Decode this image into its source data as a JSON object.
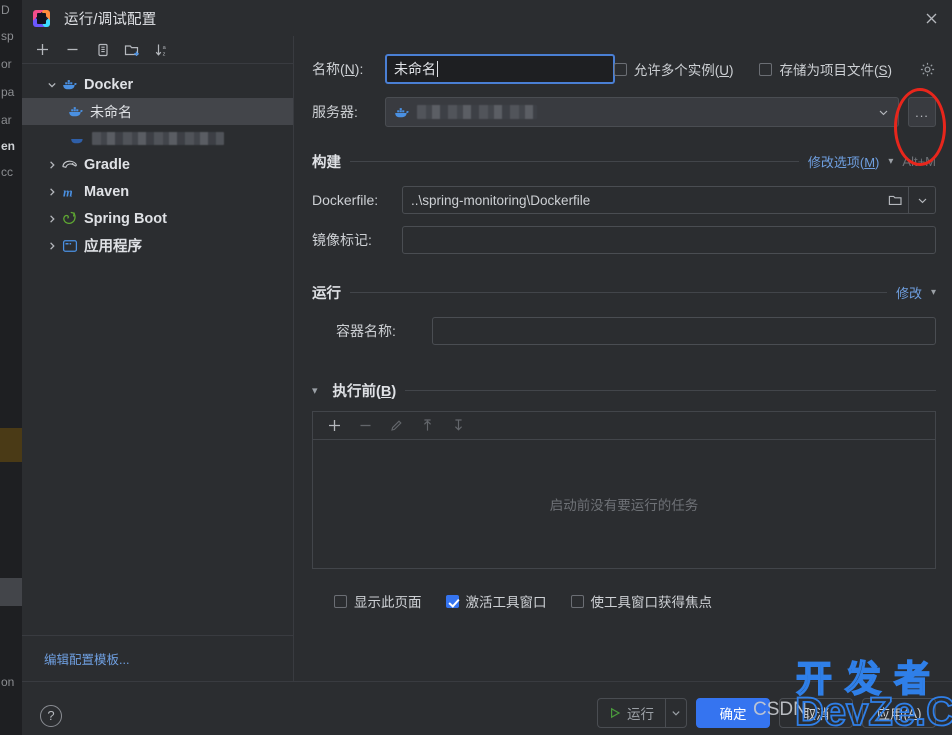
{
  "window": {
    "title": "运行/调试配置",
    "app_icon": "intellij-idea-icon",
    "close_icon": "close-icon"
  },
  "sidebar": {
    "toolbar": [
      {
        "name": "add-configuration-button",
        "icon": "plus-icon"
      },
      {
        "name": "remove-configuration-button",
        "icon": "minus-icon"
      },
      {
        "name": "copy-configuration-button",
        "icon": "copy-icon"
      },
      {
        "name": "new-folder-button",
        "icon": "new-folder-icon"
      },
      {
        "name": "sort-configurations-button",
        "icon": "sort-az-icon"
      }
    ],
    "tree": [
      {
        "label": "Docker",
        "icon": "docker-whale-icon",
        "expanded": true,
        "level": 0
      },
      {
        "label": "未命名",
        "icon": "docker-whale-icon",
        "level": 1,
        "selected": true
      },
      {
        "label": "",
        "icon": "docker-whale-icon",
        "level": 1,
        "redacted": true
      },
      {
        "label": "Gradle",
        "icon": "gradle-elephant-icon",
        "expanded": false,
        "level": 0
      },
      {
        "label": "Maven",
        "icon": "maven-m-icon",
        "expanded": false,
        "level": 0
      },
      {
        "label": "Spring Boot",
        "icon": "spring-leaf-icon",
        "expanded": false,
        "level": 0
      },
      {
        "label": "应用程序",
        "icon": "application-window-icon",
        "expanded": false,
        "level": 0
      }
    ],
    "edit_templates_link": "编辑配置模板..."
  },
  "form": {
    "name_label": "名称(",
    "name_mnemonic": "N",
    "name_label_tail": "):",
    "name_value": "未命名",
    "allow_multiple_instances": {
      "label_head": "允许多个实例(",
      "mnemonic": "U",
      "label_tail": ")",
      "checked": false
    },
    "store_as_project_file": {
      "label_head": "存储为项目文件(",
      "mnemonic": "S",
      "label_tail": ")",
      "checked": false
    },
    "gear_icon": "gear-icon",
    "server_label": "服务器:",
    "server_value": "",
    "server_icon": "docker-whale-icon",
    "server_redacted": true,
    "dots_button_label": "...",
    "annotation": "red-ellipse-highlight"
  },
  "build_section": {
    "title": "构建",
    "modify_options_head": "修改选项(",
    "modify_options_mnemonic": "M",
    "modify_options_tail": ")",
    "shortcut": "Alt+M",
    "dockerfile_label": "Dockerfile:",
    "dockerfile_value": "..\\spring-monitoring\\Dockerfile",
    "image_tag_label": "镜像标记:",
    "image_tag_value": ""
  },
  "run_section": {
    "title": "运行",
    "modify_label": "修改",
    "container_name_label": "容器名称:",
    "container_name_value": ""
  },
  "before_launch": {
    "title_head": "执行前(",
    "mnemonic": "B",
    "title_tail": ")",
    "expanded": true,
    "toolbar": [
      {
        "name": "add-task-button",
        "icon": "plus-icon"
      },
      {
        "name": "remove-task-button",
        "icon": "minus-icon"
      },
      {
        "name": "edit-task-button",
        "icon": "pencil-icon"
      },
      {
        "name": "move-task-up-button",
        "icon": "arrow-up-icon"
      },
      {
        "name": "move-task-down-button",
        "icon": "arrow-down-icon"
      }
    ],
    "empty_message": "启动前没有要运行的任务",
    "options": [
      {
        "label": "显示此页面",
        "checked": false,
        "name": "show-this-page-checkbox"
      },
      {
        "label": "激活工具窗口",
        "checked": true,
        "name": "activate-tool-window-checkbox"
      },
      {
        "label": "使工具窗口获得焦点",
        "checked": false,
        "name": "focus-tool-window-checkbox"
      }
    ]
  },
  "footer": {
    "help_label": "?",
    "run_label": "运行",
    "run_icon": "play-triangle-icon",
    "ok_label": "确定",
    "cancel_label": "取消",
    "apply_head": "应用(",
    "apply_mnemonic": "A",
    "apply_tail": ")"
  },
  "watermark": {
    "csdn": "CSDN",
    "chinese": "开发者",
    "english": "DevZe.CoM"
  },
  "ide_backdrop": {
    "ghost_lines": [
      "D",
      "sp",
      "or",
      "pa",
      "ar",
      "en",
      "cc",
      "on"
    ]
  },
  "colors": {
    "accent_blue": "#3574f0",
    "link_blue": "#6f9fe0",
    "annotation_red": "#e8261c",
    "panel_bg": "#2b2d30",
    "field_bg": "#1e1f22",
    "selection": "#43454a",
    "watermark_blue": "#2f7fe8"
  }
}
